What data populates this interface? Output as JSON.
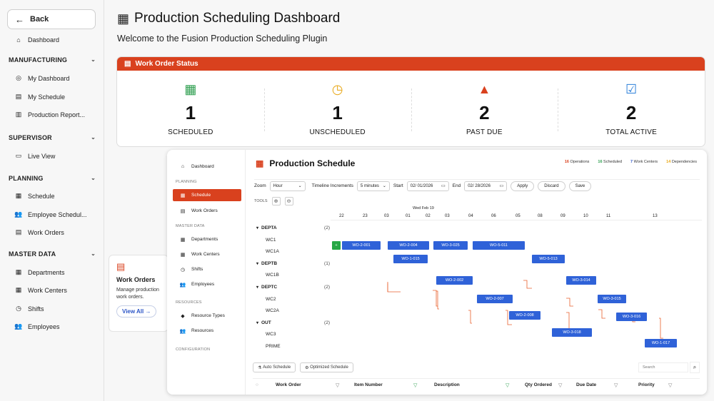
{
  "sidebar": {
    "back_label": "Back",
    "dashboard": "Dashboard",
    "sections": [
      {
        "title": "MANUFACTURING",
        "items": [
          "My Dashboard",
          "My Schedule",
          "Production Report..."
        ]
      },
      {
        "title": "SUPERVISOR",
        "items": [
          "Live View"
        ]
      },
      {
        "title": "PLANNING",
        "items": [
          "Schedule",
          "Employee Schedul...",
          "Work Orders"
        ]
      },
      {
        "title": "MASTER DATA",
        "items": [
          "Departments",
          "Work Centers",
          "Shifts",
          "Employees"
        ]
      }
    ]
  },
  "header": {
    "title": "Production Scheduling Dashboard",
    "subtitle": "Welcome to the Fusion Production Scheduling Plugin"
  },
  "work_order_status": {
    "title": "Work Order Status",
    "stats": [
      {
        "value": "1",
        "label": "SCHEDULED",
        "color": "#2e9e4f"
      },
      {
        "value": "1",
        "label": "UNSCHEDULED",
        "color": "#e8a715"
      },
      {
        "value": "2",
        "label": "PAST DUE",
        "color": "#d9411e"
      },
      {
        "value": "2",
        "label": "TOTAL ACTIVE",
        "color": "#2c7fd9"
      }
    ]
  },
  "work_orders_card": {
    "title": "Work Orders",
    "description": "Manage production work orders.",
    "button": "View All →"
  },
  "preview": {
    "sidebar": {
      "dashboard": "Dashboard",
      "planning": "PLANNING",
      "schedule": "Schedule",
      "work_orders": "Work Orders",
      "master_data": "MASTER DATA",
      "departments": "Departments",
      "work_centers": "Work Centers",
      "shifts": "Shifts",
      "employees": "Employees",
      "resources_h": "RESOURCES",
      "resource_types": "Resource Types",
      "resources": "Resources",
      "configuration": "CONFIGURATION"
    },
    "title": "Production Schedule",
    "legend": [
      {
        "count": "16",
        "label": "Operations",
        "color": "#d9411e"
      },
      {
        "count": "16",
        "label": "Scheduled",
        "color": "#2e9e4f"
      },
      {
        "count": "7",
        "label": "Work Centers",
        "color": "#2c55c7"
      },
      {
        "count": "14",
        "label": "Dependencies",
        "color": "#e8a715"
      }
    ],
    "controls": {
      "zoom_label": "Zoom",
      "zoom_value": "Hour",
      "increment_label": "Timeline Increments",
      "increment_value": "5 minutes",
      "start_label": "Start",
      "start_value": "02/ 01/2026",
      "end_label": "End",
      "end_value": "02/ 28/2026",
      "apply": "Apply",
      "discard": "Discard",
      "save": "Save"
    },
    "tools_label": "TOOLS",
    "timeline_date": "Wed Feb 19",
    "ticks": [
      "22",
      "23",
      "03",
      "01",
      "02",
      "03",
      "04",
      "06",
      "05",
      "08",
      "09",
      "10",
      "11",
      "13"
    ],
    "groups": [
      {
        "name": "DEPTA",
        "count": "(2)",
        "centers": [
          "WC1",
          "WC1A"
        ]
      },
      {
        "name": "DEPTB",
        "count": "(1)",
        "centers": [
          "WC1B"
        ]
      },
      {
        "name": "DEPTC",
        "count": "(2)",
        "centers": [
          "WC2",
          "WC2A"
        ]
      },
      {
        "name": "OUT",
        "count": "(2)",
        "centers": [
          "WC3",
          "PRIME"
        ]
      }
    ],
    "bars": [
      {
        "label": "WO-2-001",
        "row": 1
      },
      {
        "label": "WO-2-004",
        "row": 1
      },
      {
        "label": "WO-3-025",
        "row": 1
      },
      {
        "label": "WO-5-011",
        "row": 1
      },
      {
        "label": "WO-1-015",
        "row": 2
      },
      {
        "label": "WO-5-013",
        "row": 2
      },
      {
        "label": "WO-2-002",
        "row": 4
      },
      {
        "label": "WO-3-014",
        "row": 4
      },
      {
        "label": "WO-2-007",
        "row": 6
      },
      {
        "label": "WO-3-015",
        "row": 6
      },
      {
        "label": "WO-2-008",
        "row": 7
      },
      {
        "label": "WO-3-016",
        "row": 7
      },
      {
        "label": "WO-3-018",
        "row": 9
      },
      {
        "label": "WO-1-017",
        "row": 10
      }
    ],
    "bottom": {
      "auto": "Auto Schedule",
      "optimized": "Optimized Schedule",
      "search_placeholder": "Search"
    },
    "columns": [
      "Work Order",
      "Item Number",
      "Description",
      "Qty Ordered",
      "Due Date",
      "Priority"
    ]
  }
}
